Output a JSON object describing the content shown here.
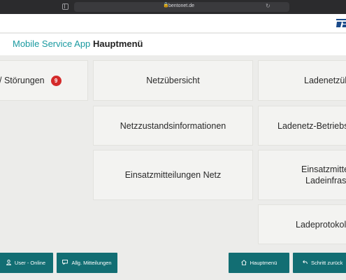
{
  "browser": {
    "url_host": "bentonet.de",
    "lock_icon": "lock-icon",
    "reload_icon": "reload-icon"
  },
  "logo": {
    "name": "company-logo"
  },
  "header": {
    "app_title": "Mobile Service App",
    "page_title": "Hauptmenü"
  },
  "menu": {
    "stoerungen": {
      "label": "/ Störungen",
      "badge": "9"
    },
    "netzuebersicht": "Netzübersicht",
    "ladenetzuebersicht": "Ladenetzüb",
    "netzzustand": "Netzzustandsinformationen",
    "ladenetz_betrieb": "Ladenetz-Betriebsi",
    "einsatz_netz": "Einsatzmitteilungen Netz",
    "einsatz_lade_line1": "Einsatzmitte",
    "einsatz_lade_line2": "Ladeinfrast",
    "ladeprotokoll": "Ladeprotokoll"
  },
  "footer": {
    "user": {
      "label": "User - Online",
      "icon": "user-icon"
    },
    "mitteilungen": {
      "label": "Allg. Mitteilungen",
      "icon": "message-icon"
    },
    "hauptmenu": {
      "label": "Hauptmenü",
      "icon": "home-icon"
    },
    "zurueck": {
      "label": "Schritt zurück",
      "icon": "back-arrow-icon"
    }
  },
  "colors": {
    "accent": "#1a9aa0",
    "footer_button": "#126e73",
    "badge": "#d42a2a",
    "tile": "#f3f3f1",
    "background": "#ececea"
  }
}
